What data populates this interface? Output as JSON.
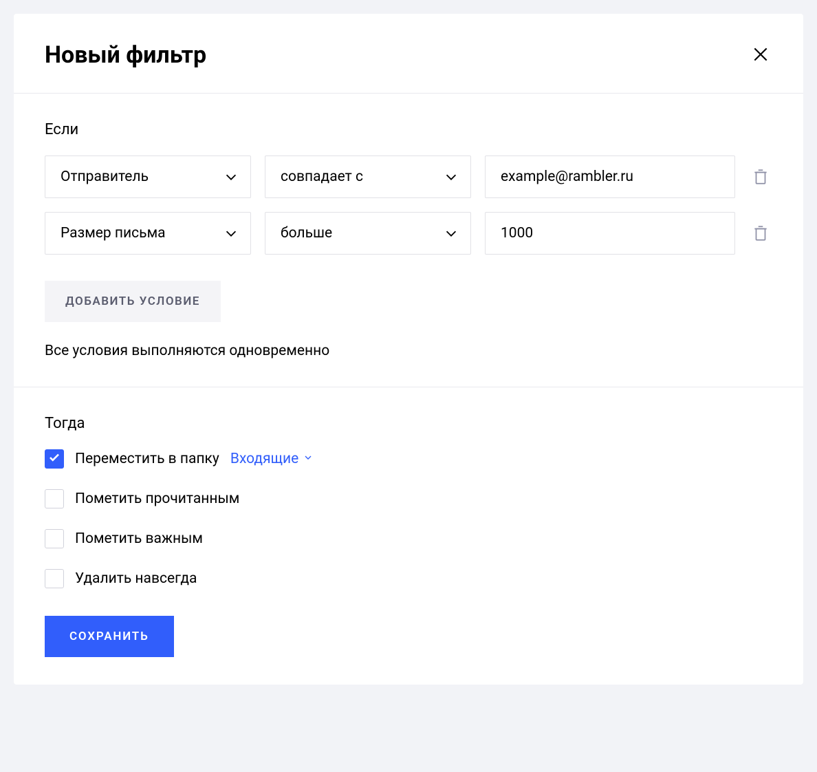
{
  "modal": {
    "title": "Новый фильтр"
  },
  "if_section": {
    "label": "Если",
    "conditions": [
      {
        "field": "Отправитель",
        "operator": "совпадает с",
        "value": "example@rambler.ru"
      },
      {
        "field": "Размер письма",
        "operator": "больше",
        "value": "1000"
      }
    ],
    "add_button": "Добавить условие",
    "hint": "Все условия выполняются одновременно"
  },
  "then_section": {
    "label": "Тогда",
    "actions": {
      "move_to_folder": {
        "label": "Переместить в папку",
        "folder": "Входящие",
        "checked": true
      },
      "mark_read": {
        "label": "Пометить прочитанным",
        "checked": false
      },
      "mark_important": {
        "label": "Пометить важным",
        "checked": false
      },
      "delete_forever": {
        "label": "Удалить навсегда",
        "checked": false
      }
    }
  },
  "save_button": "Сохранить"
}
